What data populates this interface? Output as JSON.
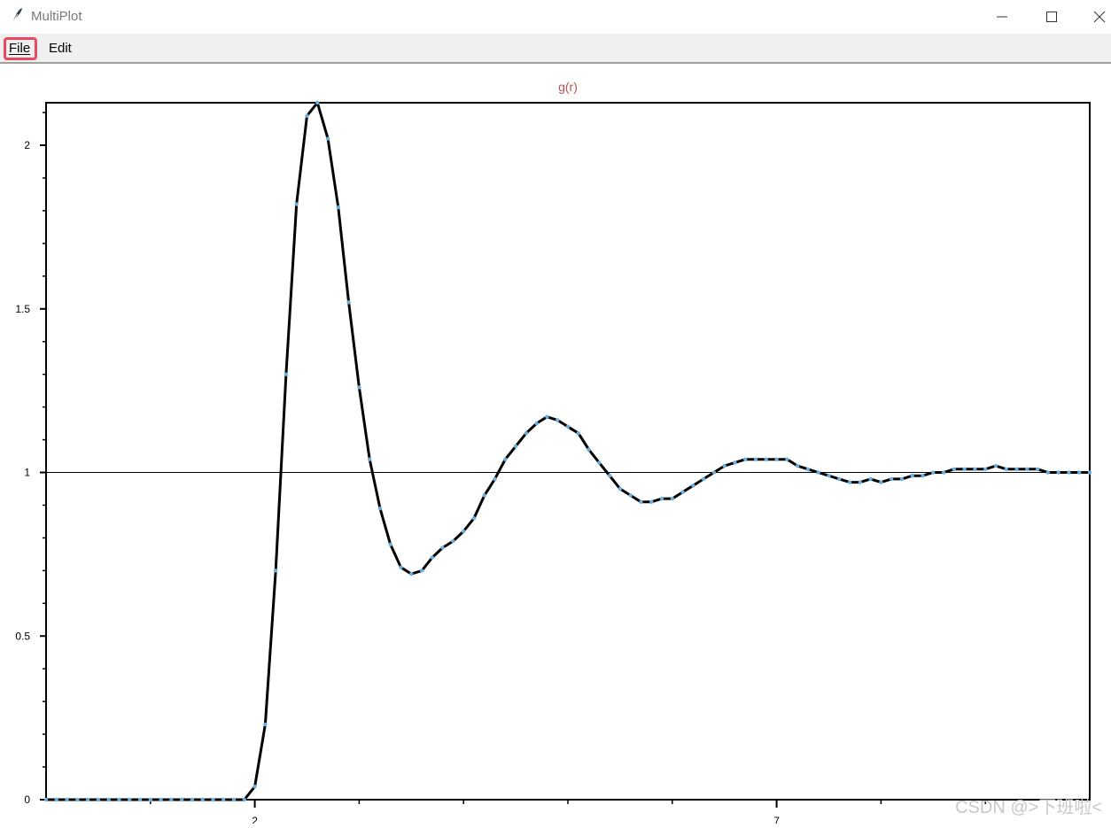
{
  "window": {
    "title": "MultiPlot",
    "icon": "feather-icon"
  },
  "menubar": {
    "items": [
      {
        "label": "File",
        "highlighted": true
      },
      {
        "label": "Edit",
        "highlighted": false
      }
    ],
    "highlight_color": "#e84a5f"
  },
  "chart_data": {
    "type": "line",
    "title": "g(r)",
    "title_color": "#c0504d",
    "xlabel": "",
    "ylabel": "",
    "xlim": [
      0.0,
      10.0
    ],
    "ylim": [
      0,
      2.13
    ],
    "x_ticks": [
      2,
      7
    ],
    "y_ticks": [
      0,
      0.5,
      1,
      1.5,
      2
    ],
    "x_tick_labels": [
      "2",
      "7"
    ],
    "y_tick_labels": [
      "0",
      "0.5",
      "1",
      "1.5",
      "2"
    ],
    "reference_line": {
      "y": 1.0
    },
    "grid": false,
    "legend": "none",
    "series": [
      {
        "line_color": "#000000",
        "marker_color": "#6aaee0",
        "x": [
          0.0,
          0.1,
          0.2,
          0.3,
          0.4,
          0.5,
          0.6,
          0.7,
          0.8,
          0.9,
          1.0,
          1.1,
          1.2,
          1.3,
          1.4,
          1.5,
          1.6,
          1.7,
          1.8,
          1.9,
          2.0,
          2.1,
          2.2,
          2.3,
          2.4,
          2.5,
          2.6,
          2.7,
          2.8,
          2.9,
          3.0,
          3.1,
          3.2,
          3.3,
          3.4,
          3.5,
          3.6,
          3.7,
          3.8,
          3.9,
          4.0,
          4.1,
          4.2,
          4.3,
          4.4,
          4.5,
          4.6,
          4.7,
          4.8,
          4.9,
          5.0,
          5.1,
          5.2,
          5.3,
          5.4,
          5.5,
          5.6,
          5.7,
          5.8,
          5.9,
          6.0,
          6.1,
          6.2,
          6.3,
          6.4,
          6.5,
          6.6,
          6.7,
          6.8,
          6.9,
          7.0,
          7.1,
          7.2,
          7.3,
          7.4,
          7.5,
          7.6,
          7.7,
          7.8,
          7.9,
          8.0,
          8.1,
          8.2,
          8.3,
          8.4,
          8.5,
          8.6,
          8.7,
          8.8,
          8.9,
          9.0,
          9.1,
          9.2,
          9.3,
          9.4,
          9.5,
          9.6,
          9.7,
          9.8,
          9.9,
          10.0
        ],
        "y": [
          0,
          0,
          0,
          0,
          0,
          0,
          0,
          0,
          0,
          0,
          0,
          0,
          0,
          0,
          0,
          0,
          0,
          0,
          0,
          0,
          0.04,
          0.23,
          0.7,
          1.3,
          1.82,
          2.09,
          2.13,
          2.02,
          1.81,
          1.52,
          1.26,
          1.04,
          0.89,
          0.78,
          0.71,
          0.69,
          0.7,
          0.74,
          0.77,
          0.79,
          0.82,
          0.86,
          0.93,
          0.98,
          1.04,
          1.08,
          1.12,
          1.15,
          1.17,
          1.16,
          1.14,
          1.12,
          1.07,
          1.03,
          0.99,
          0.95,
          0.93,
          0.91,
          0.91,
          0.92,
          0.92,
          0.94,
          0.96,
          0.98,
          1.0,
          1.02,
          1.03,
          1.04,
          1.04,
          1.04,
          1.04,
          1.04,
          1.02,
          1.01,
          1.0,
          0.99,
          0.98,
          0.97,
          0.97,
          0.98,
          0.97,
          0.98,
          0.98,
          0.99,
          0.99,
          1.0,
          1.0,
          1.01,
          1.01,
          1.01,
          1.01,
          1.02,
          1.01,
          1.01,
          1.01,
          1.01,
          1.0,
          1.0,
          1.0,
          1.0,
          1.0
        ]
      }
    ]
  },
  "watermark": "CSDN @>下班啦<"
}
